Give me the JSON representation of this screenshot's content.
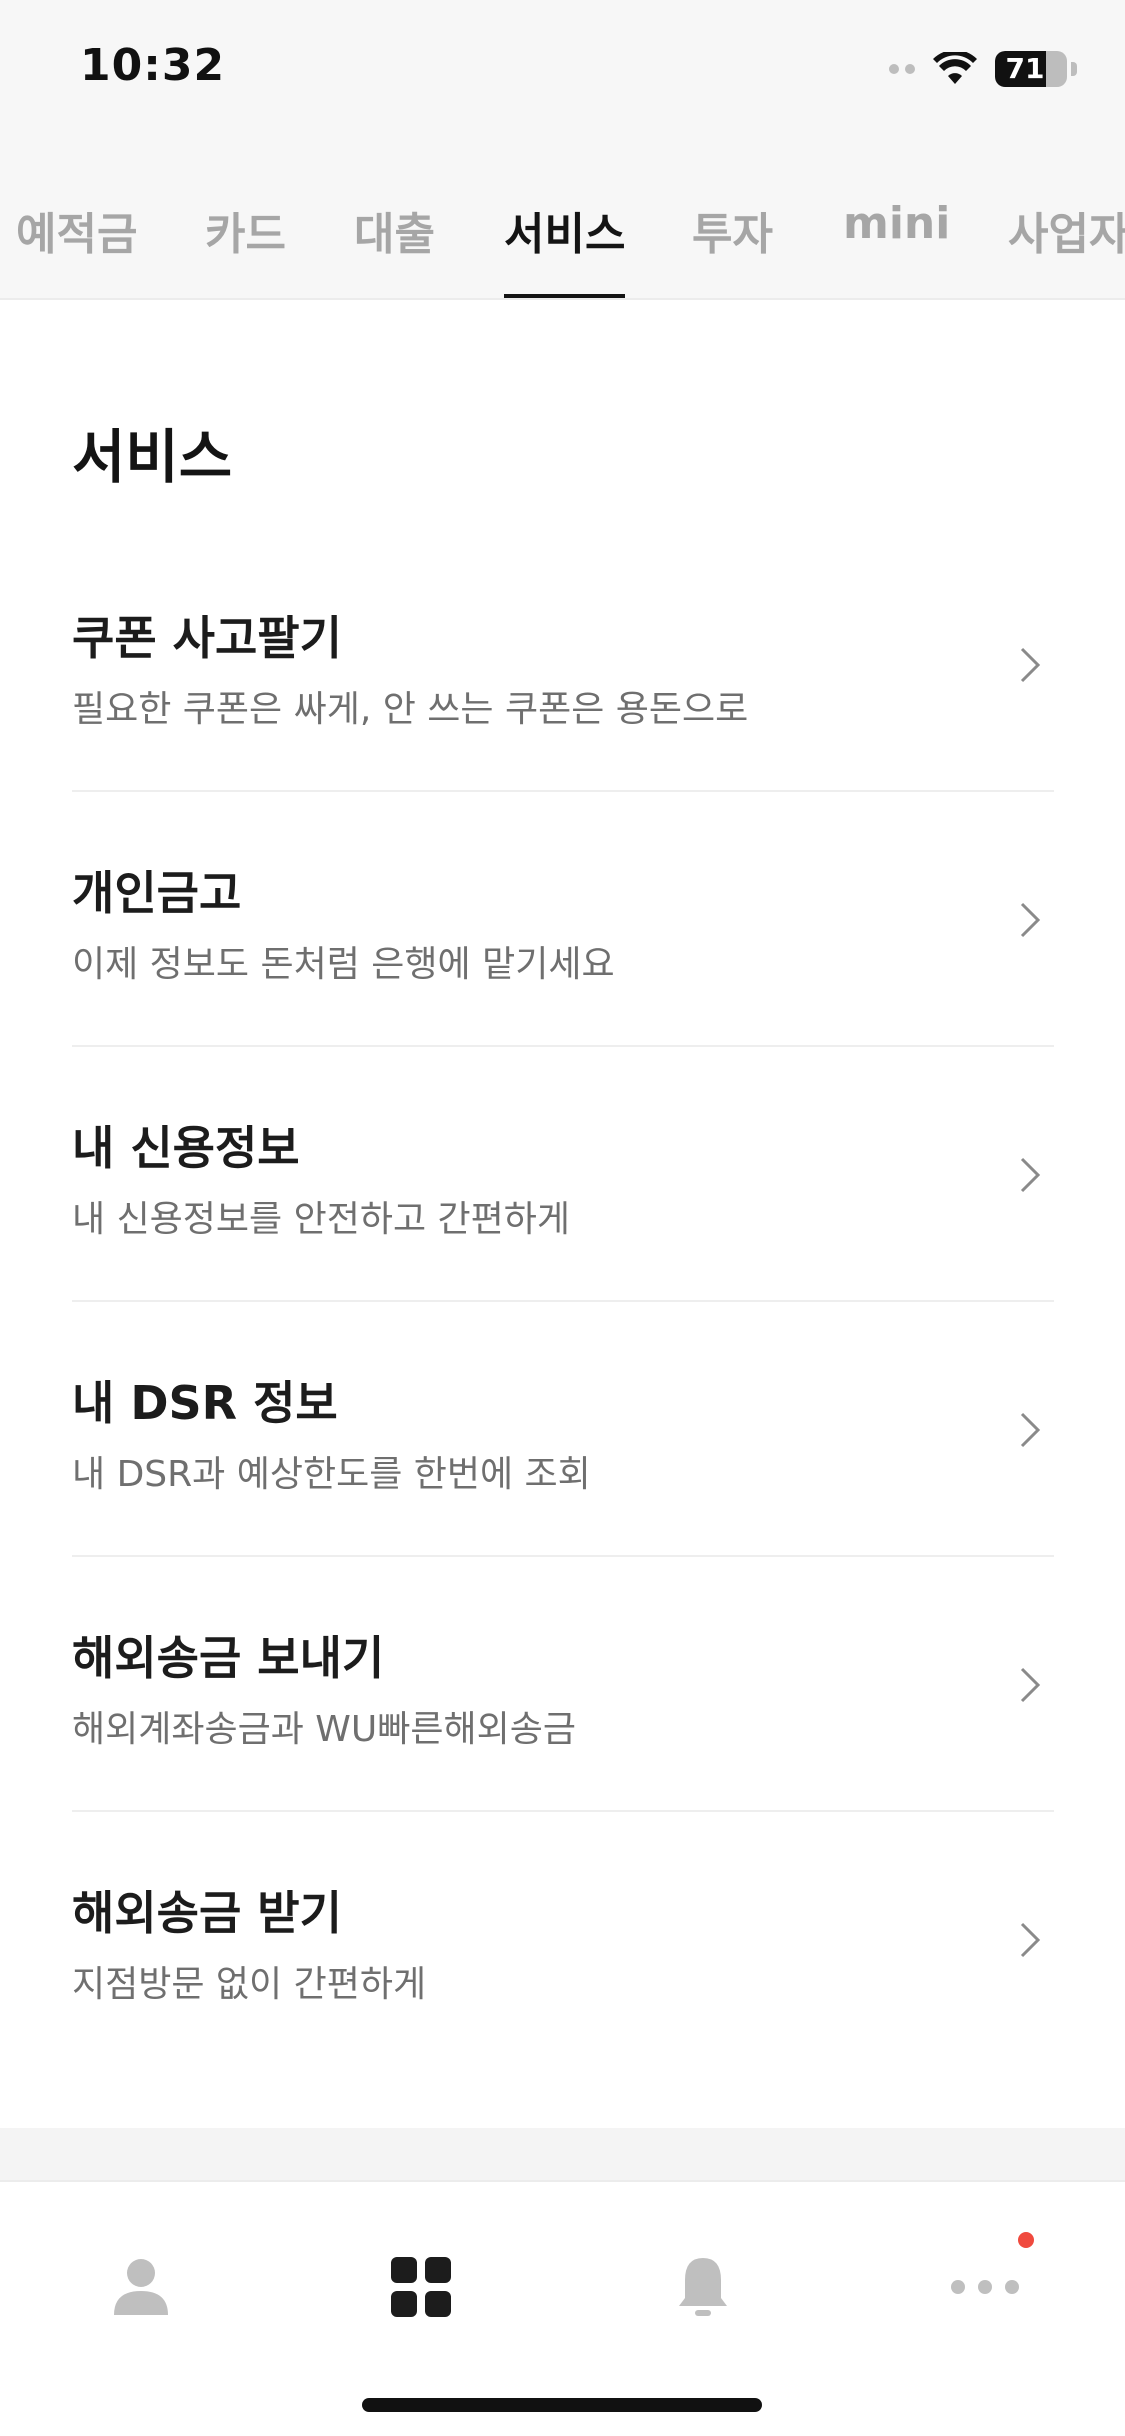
{
  "status_bar": {
    "time": "10:32",
    "battery_text": "71",
    "battery_level": 0.71
  },
  "tabs": [
    {
      "label": "예적금",
      "active": false
    },
    {
      "label": "카드",
      "active": false
    },
    {
      "label": "대출",
      "active": false
    },
    {
      "label": "서비스",
      "active": true
    },
    {
      "label": "투자",
      "active": false
    },
    {
      "label": "mini",
      "active": false
    },
    {
      "label": "사업자",
      "active": false
    }
  ],
  "page": {
    "title": "서비스"
  },
  "services": [
    {
      "title": "쿠폰 사고팔기",
      "subtitle": "필요한 쿠폰은 싸게, 안 쓰는 쿠폰은 용돈으로"
    },
    {
      "title": "개인금고",
      "subtitle": "이제 정보도 돈처럼 은행에 맡기세요"
    },
    {
      "title": "내 신용정보",
      "subtitle": "내 신용정보를 안전하고 간편하게"
    },
    {
      "title": "내 DSR 정보",
      "subtitle": "내 DSR과 예상한도를 한번에 조회"
    },
    {
      "title": "해외송금 보내기",
      "subtitle": "해외계좌송금과 WU빠른해외송금"
    },
    {
      "title": "해외송금 받기",
      "subtitle": "지점방문 없이 간편하게"
    }
  ],
  "bottom_nav": [
    {
      "icon": "person-icon",
      "active": false
    },
    {
      "icon": "grid-icon",
      "active": true
    },
    {
      "icon": "bell-icon",
      "active": false
    },
    {
      "icon": "more-icon",
      "active": false,
      "has_badge": true
    }
  ],
  "colors": {
    "active": "#141414",
    "inactive": "#a6a6a6",
    "subtitle": "#6f6f6f",
    "badge": "#f04a3e"
  }
}
